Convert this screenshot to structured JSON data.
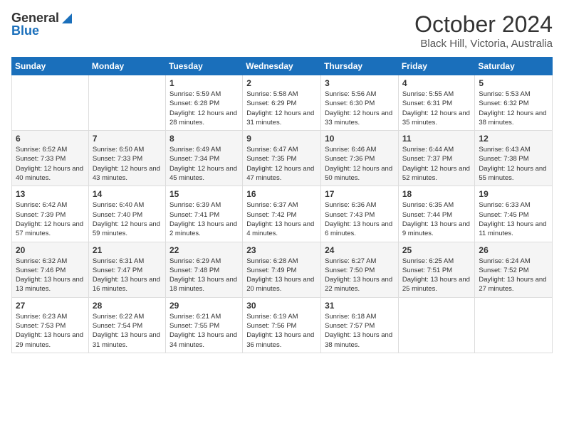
{
  "logo": {
    "line1": "General",
    "line2": "Blue"
  },
  "title": "October 2024",
  "subtitle": "Black Hill, Victoria, Australia",
  "weekdays": [
    "Sunday",
    "Monday",
    "Tuesday",
    "Wednesday",
    "Thursday",
    "Friday",
    "Saturday"
  ],
  "rows": [
    [
      {
        "day": "",
        "info": ""
      },
      {
        "day": "",
        "info": ""
      },
      {
        "day": "1",
        "info": "Sunrise: 5:59 AM\nSunset: 6:28 PM\nDaylight: 12 hours and 28 minutes."
      },
      {
        "day": "2",
        "info": "Sunrise: 5:58 AM\nSunset: 6:29 PM\nDaylight: 12 hours and 31 minutes."
      },
      {
        "day": "3",
        "info": "Sunrise: 5:56 AM\nSunset: 6:30 PM\nDaylight: 12 hours and 33 minutes."
      },
      {
        "day": "4",
        "info": "Sunrise: 5:55 AM\nSunset: 6:31 PM\nDaylight: 12 hours and 35 minutes."
      },
      {
        "day": "5",
        "info": "Sunrise: 5:53 AM\nSunset: 6:32 PM\nDaylight: 12 hours and 38 minutes."
      }
    ],
    [
      {
        "day": "6",
        "info": "Sunrise: 6:52 AM\nSunset: 7:33 PM\nDaylight: 12 hours and 40 minutes."
      },
      {
        "day": "7",
        "info": "Sunrise: 6:50 AM\nSunset: 7:33 PM\nDaylight: 12 hours and 43 minutes."
      },
      {
        "day": "8",
        "info": "Sunrise: 6:49 AM\nSunset: 7:34 PM\nDaylight: 12 hours and 45 minutes."
      },
      {
        "day": "9",
        "info": "Sunrise: 6:47 AM\nSunset: 7:35 PM\nDaylight: 12 hours and 47 minutes."
      },
      {
        "day": "10",
        "info": "Sunrise: 6:46 AM\nSunset: 7:36 PM\nDaylight: 12 hours and 50 minutes."
      },
      {
        "day": "11",
        "info": "Sunrise: 6:44 AM\nSunset: 7:37 PM\nDaylight: 12 hours and 52 minutes."
      },
      {
        "day": "12",
        "info": "Sunrise: 6:43 AM\nSunset: 7:38 PM\nDaylight: 12 hours and 55 minutes."
      }
    ],
    [
      {
        "day": "13",
        "info": "Sunrise: 6:42 AM\nSunset: 7:39 PM\nDaylight: 12 hours and 57 minutes."
      },
      {
        "day": "14",
        "info": "Sunrise: 6:40 AM\nSunset: 7:40 PM\nDaylight: 12 hours and 59 minutes."
      },
      {
        "day": "15",
        "info": "Sunrise: 6:39 AM\nSunset: 7:41 PM\nDaylight: 13 hours and 2 minutes."
      },
      {
        "day": "16",
        "info": "Sunrise: 6:37 AM\nSunset: 7:42 PM\nDaylight: 13 hours and 4 minutes."
      },
      {
        "day": "17",
        "info": "Sunrise: 6:36 AM\nSunset: 7:43 PM\nDaylight: 13 hours and 6 minutes."
      },
      {
        "day": "18",
        "info": "Sunrise: 6:35 AM\nSunset: 7:44 PM\nDaylight: 13 hours and 9 minutes."
      },
      {
        "day": "19",
        "info": "Sunrise: 6:33 AM\nSunset: 7:45 PM\nDaylight: 13 hours and 11 minutes."
      }
    ],
    [
      {
        "day": "20",
        "info": "Sunrise: 6:32 AM\nSunset: 7:46 PM\nDaylight: 13 hours and 13 minutes."
      },
      {
        "day": "21",
        "info": "Sunrise: 6:31 AM\nSunset: 7:47 PM\nDaylight: 13 hours and 16 minutes."
      },
      {
        "day": "22",
        "info": "Sunrise: 6:29 AM\nSunset: 7:48 PM\nDaylight: 13 hours and 18 minutes."
      },
      {
        "day": "23",
        "info": "Sunrise: 6:28 AM\nSunset: 7:49 PM\nDaylight: 13 hours and 20 minutes."
      },
      {
        "day": "24",
        "info": "Sunrise: 6:27 AM\nSunset: 7:50 PM\nDaylight: 13 hours and 22 minutes."
      },
      {
        "day": "25",
        "info": "Sunrise: 6:25 AM\nSunset: 7:51 PM\nDaylight: 13 hours and 25 minutes."
      },
      {
        "day": "26",
        "info": "Sunrise: 6:24 AM\nSunset: 7:52 PM\nDaylight: 13 hours and 27 minutes."
      }
    ],
    [
      {
        "day": "27",
        "info": "Sunrise: 6:23 AM\nSunset: 7:53 PM\nDaylight: 13 hours and 29 minutes."
      },
      {
        "day": "28",
        "info": "Sunrise: 6:22 AM\nSunset: 7:54 PM\nDaylight: 13 hours and 31 minutes."
      },
      {
        "day": "29",
        "info": "Sunrise: 6:21 AM\nSunset: 7:55 PM\nDaylight: 13 hours and 34 minutes."
      },
      {
        "day": "30",
        "info": "Sunrise: 6:19 AM\nSunset: 7:56 PM\nDaylight: 13 hours and 36 minutes."
      },
      {
        "day": "31",
        "info": "Sunrise: 6:18 AM\nSunset: 7:57 PM\nDaylight: 13 hours and 38 minutes."
      },
      {
        "day": "",
        "info": ""
      },
      {
        "day": "",
        "info": ""
      }
    ]
  ]
}
